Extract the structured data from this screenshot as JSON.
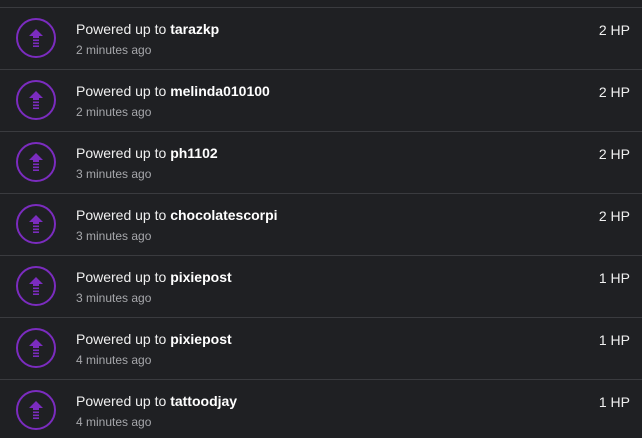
{
  "feed": {
    "items": [
      {
        "prefix": "Powered up to",
        "user": "tarazkp",
        "time": "2 minutes ago",
        "hp": "2 HP"
      },
      {
        "prefix": "Powered up to",
        "user": "melinda010100",
        "time": "2 minutes ago",
        "hp": "2 HP"
      },
      {
        "prefix": "Powered up to",
        "user": "ph1102",
        "time": "3 minutes ago",
        "hp": "2 HP"
      },
      {
        "prefix": "Powered up to",
        "user": "chocolatescorpi",
        "time": "3 minutes ago",
        "hp": "2 HP"
      },
      {
        "prefix": "Powered up to",
        "user": "pixiepost",
        "time": "3 minutes ago",
        "hp": "1 HP"
      },
      {
        "prefix": "Powered up to",
        "user": "pixiepost",
        "time": "4 minutes ago",
        "hp": "1 HP"
      },
      {
        "prefix": "Powered up to",
        "user": "tattoodjay",
        "time": "4 minutes ago",
        "hp": "1 HP"
      }
    ],
    "icon": "power-up-arrow-icon",
    "accent_color": "#7b2cbf"
  }
}
